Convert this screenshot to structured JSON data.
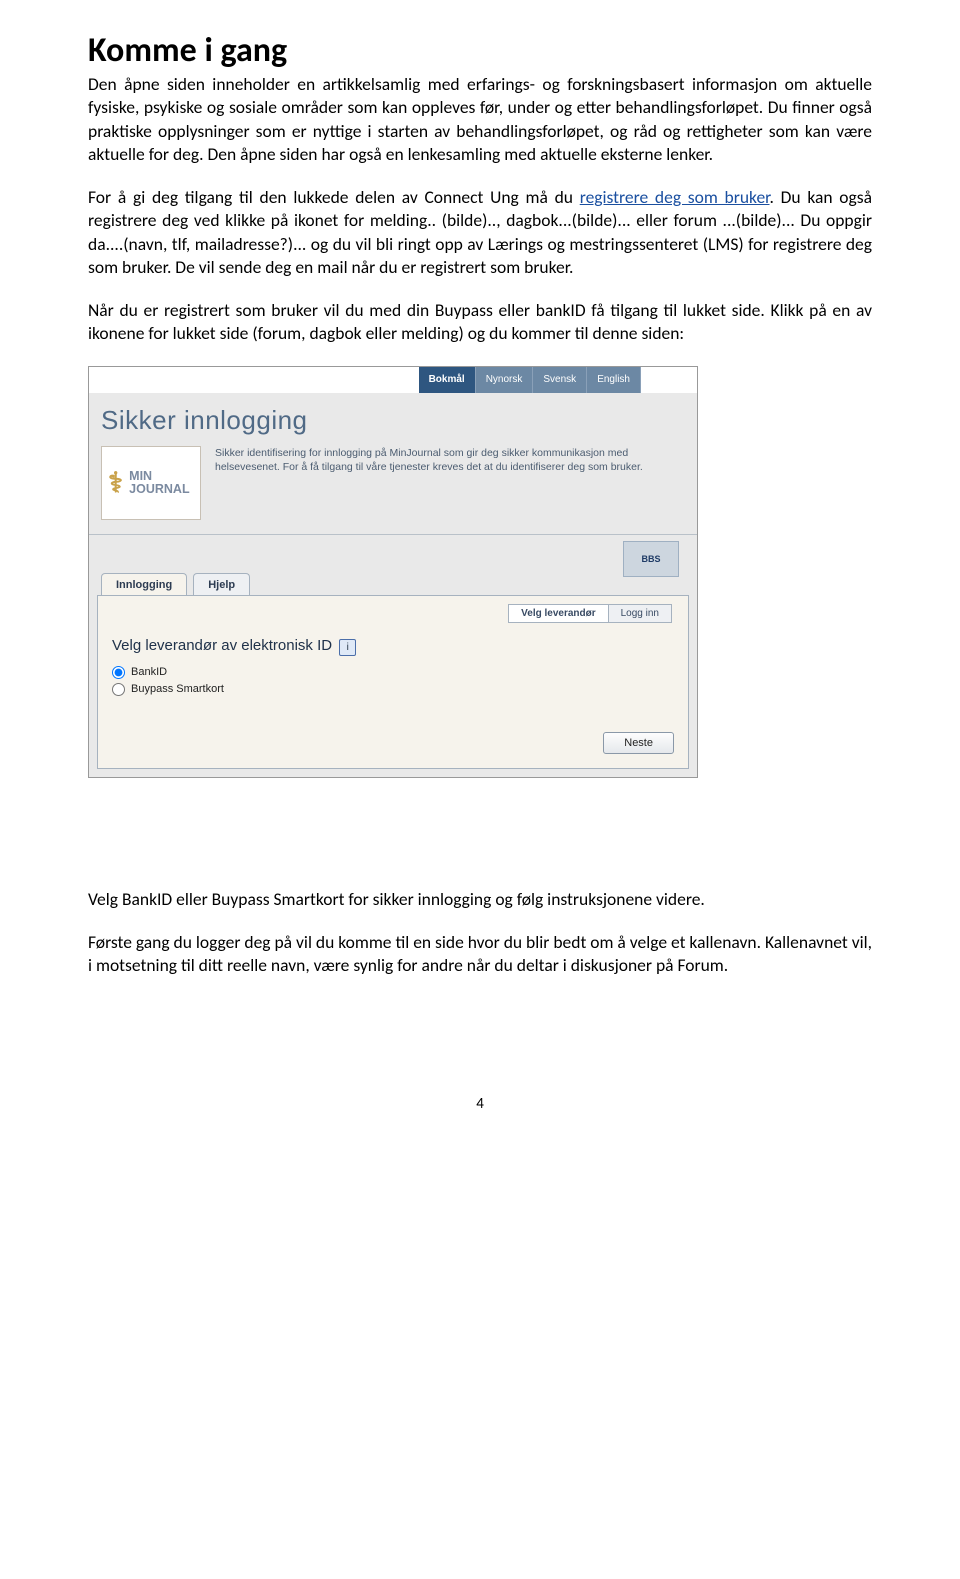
{
  "heading": "Komme i gang",
  "p1": "Den åpne siden inneholder en artikkelsamlig med erfarings- og forskningsbasert informasjon om aktuelle fysiske, psykiske og sosiale områder som kan oppleves før, under og etter behandlingsforløpet. Du finner også praktiske opplysninger som er nyttige i starten av behandlingsforløpet, og råd og rettigheter som kan være aktuelle for deg. Den åpne siden har også en lenkesamling med aktuelle eksterne lenker.",
  "p2a": "For å gi deg tilgang til den lukkede delen av Connect Ung må du ",
  "p2_link": "registrere deg som bruker",
  "p2b": ". Du kan også registrere deg ved klikke på ikonet for melding.. (bilde).., dagbok...(bilde)... eller forum ...(bilde)... Du oppgir da....(navn, tlf, mailadresse?)... og du vil bli ringt opp av Lærings og mestringssenteret (LMS) for registrere deg som bruker. De vil sende deg en mail når du er registrert som bruker.",
  "p3": "Når du er registrert som bruker vil du med din Buypass eller bankID få tilgang til lukket side. Klikk på en av ikonene for lukket side (forum, dagbok eller melding) og du kommer til denne siden:",
  "shot": {
    "lang": {
      "active": "Bokmål",
      "others": [
        "Nynorsk",
        "Svensk",
        "English"
      ]
    },
    "title": "Sikker innlogging",
    "logo": "MIN JOURNAL",
    "desc": "Sikker identifisering for innlogging på MinJournal som gir deg sikker kommunikasjon med helsevesenet. For å få tilgang til våre tjenester kreves det at du identifiserer deg som bruker.",
    "bbs": "BBS",
    "tab_login": "Innlogging",
    "tab_help": "Hjelp",
    "step1": "Velg leverandør",
    "step2": "Logg inn",
    "panel_h": "Velg leverandør av elektronisk ID",
    "opt1": "BankID",
    "opt2": "Buypass Smartkort",
    "btn": "Neste"
  },
  "p4": "Velg BankID eller Buypass Smartkort for sikker innlogging og følg instruksjonene videre.",
  "p5": "Første gang du logger deg på vil du komme til en side hvor du blir bedt om å velge et kallenavn. Kallenavnet vil, i motsetning til ditt reelle navn,  være synlig for andre når du deltar i diskusjoner på Forum.",
  "pagenum": "4"
}
